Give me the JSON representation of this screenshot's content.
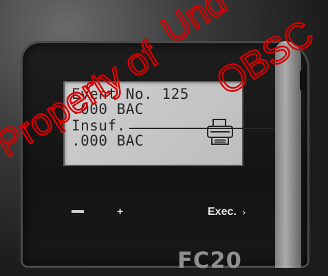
{
  "lcd": {
    "line1": "Event No. 125",
    "line2": ".000 BAC",
    "line3": "Insuf.",
    "line4": ".000 BAC"
  },
  "icons": {
    "printer": "printer-icon",
    "minus": "minus-key-icon",
    "plus": "plus-key-icon"
  },
  "keys": {
    "minus": "−",
    "plus": "+",
    "exec": "Exec."
  },
  "device": {
    "model": "FC20"
  },
  "watermark": {
    "text1": "Property of",
    "text2": "Und",
    "text3": "OBSC"
  },
  "colors": {
    "lcd_bg": "#c6c6c6",
    "lcd_text": "#262626",
    "watermark": "#d40000"
  }
}
